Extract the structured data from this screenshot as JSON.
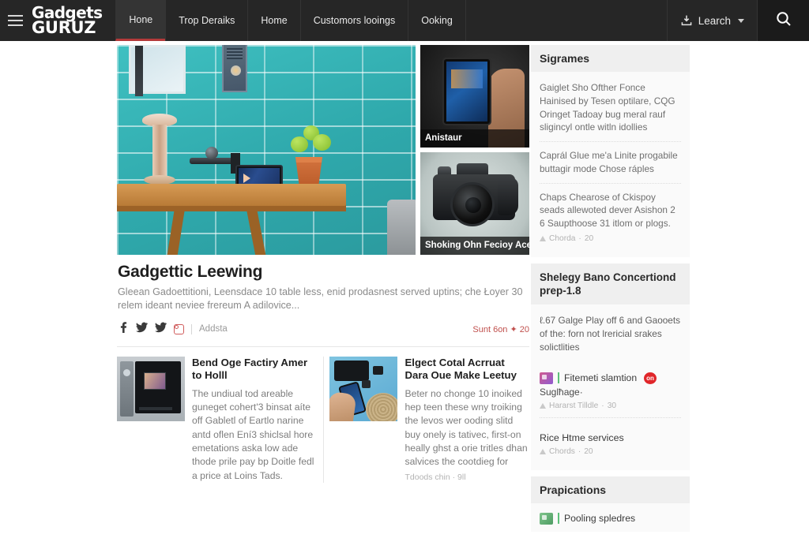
{
  "header": {
    "menu_icon": "hamburger-icon",
    "logo_line1": "Gadgets",
    "logo_line2": "GURUZ",
    "nav": [
      {
        "label": "Hone",
        "active": true
      },
      {
        "label": "Trop Deraiks",
        "active": false
      },
      {
        "label": "Home",
        "active": false
      },
      {
        "label": "Customors looings",
        "active": false
      },
      {
        "label": "Ooking",
        "active": false
      }
    ],
    "account_label": "Learch",
    "account_icon": "download-tray-icon",
    "caret_icon": "chevron-down-icon",
    "search_icon": "search-icon"
  },
  "hero": {
    "main_image_alt": "teal-tile-wall-table-tablet-photo",
    "side_cards": [
      {
        "caption": "Anistaur",
        "image_alt": "hand-holding-smartphone-photo"
      },
      {
        "caption": "Shoking Ohn Fecioy Aceer",
        "image_alt": "dslr-camera-photo"
      }
    ]
  },
  "lead": {
    "title": "Gadgettic Leewing",
    "text": "Gleean Gadoettitioni, Leensdace 10 table less, enid prodasnest served uptins; che Łoyer 30 relem ideant neviee frereum A adilovice...",
    "social": [
      {
        "icon": "facebook-icon"
      },
      {
        "icon": "twitter-icon"
      },
      {
        "icon": "twitter-icon"
      },
      {
        "icon": "instagram-icon"
      }
    ],
    "meta_label": "Addsta",
    "meta_right": "Sunt 6on ✦ 20",
    "accent_color": "#c0504d"
  },
  "cards": [
    {
      "title": "Bend Oge Factiry Amer to Holll",
      "text": "The undiual tod areable guneget cohert'3 binsat aíte off Gabletl of Eartlo narine antd oflen Ení3 shiclsal hore emetations aska low ade thode prile pay bp Doitle fedl a price at Loins Tads.",
      "image_alt": "microwave-oven-thumbnail"
    },
    {
      "title": "Elgect Cotal Acrruat Dara Oue Make Leetuy",
      "text": "Beter no chonge 10 inoiked hep teen these wny troiking the levos wer ooding slitd buy onely is tativec, first-on heally ghst a orie tritles dhan salvices the cootdieg for",
      "footer": "Tdoods chin · 9ll",
      "image_alt": "gadgets-flatlay-thumbnail"
    }
  ],
  "sidebar": {
    "block1": {
      "heading": "Sigrames",
      "items": [
        {
          "text": "Gaiglet Sho Ofther Fonce Hainised by Tesen optilare, CQG Oringet Tadoay bug meral rauf sligincyl ontle witln idollies"
        },
        {
          "text": "Caprál Glue me'a Linite progabile buttagir mode Chose ráples"
        },
        {
          "text": "Chaps Chearose of Ckispoy seads allewoted dever Asishon 2 6 Saupthoose 31 itlom or plogs.",
          "byline_author": "Chorda",
          "byline_count": "20"
        }
      ]
    },
    "block2": {
      "heading": "Shelegy Bano Concertiond prep-1.8",
      "lede": "ℓ.67 Galge Play off 6 and Gaooets of the: forn not lrericial srakes solictlities",
      "link_row": {
        "thumb": "magazine-thumbnail",
        "label": "Fitemeti slamtion",
        "badge": "on",
        "subtitle": "Suglħage·",
        "byline_author": "Hararst Tilldle",
        "byline_count": "30"
      },
      "plain_item": {
        "label": "Rice Htme services",
        "byline_author": "Chords",
        "byline_count": "20"
      }
    },
    "block3": {
      "heading": "Prapications",
      "link_row": {
        "thumb": "truck-thumbnail",
        "label": "Pooling spledres"
      }
    }
  }
}
